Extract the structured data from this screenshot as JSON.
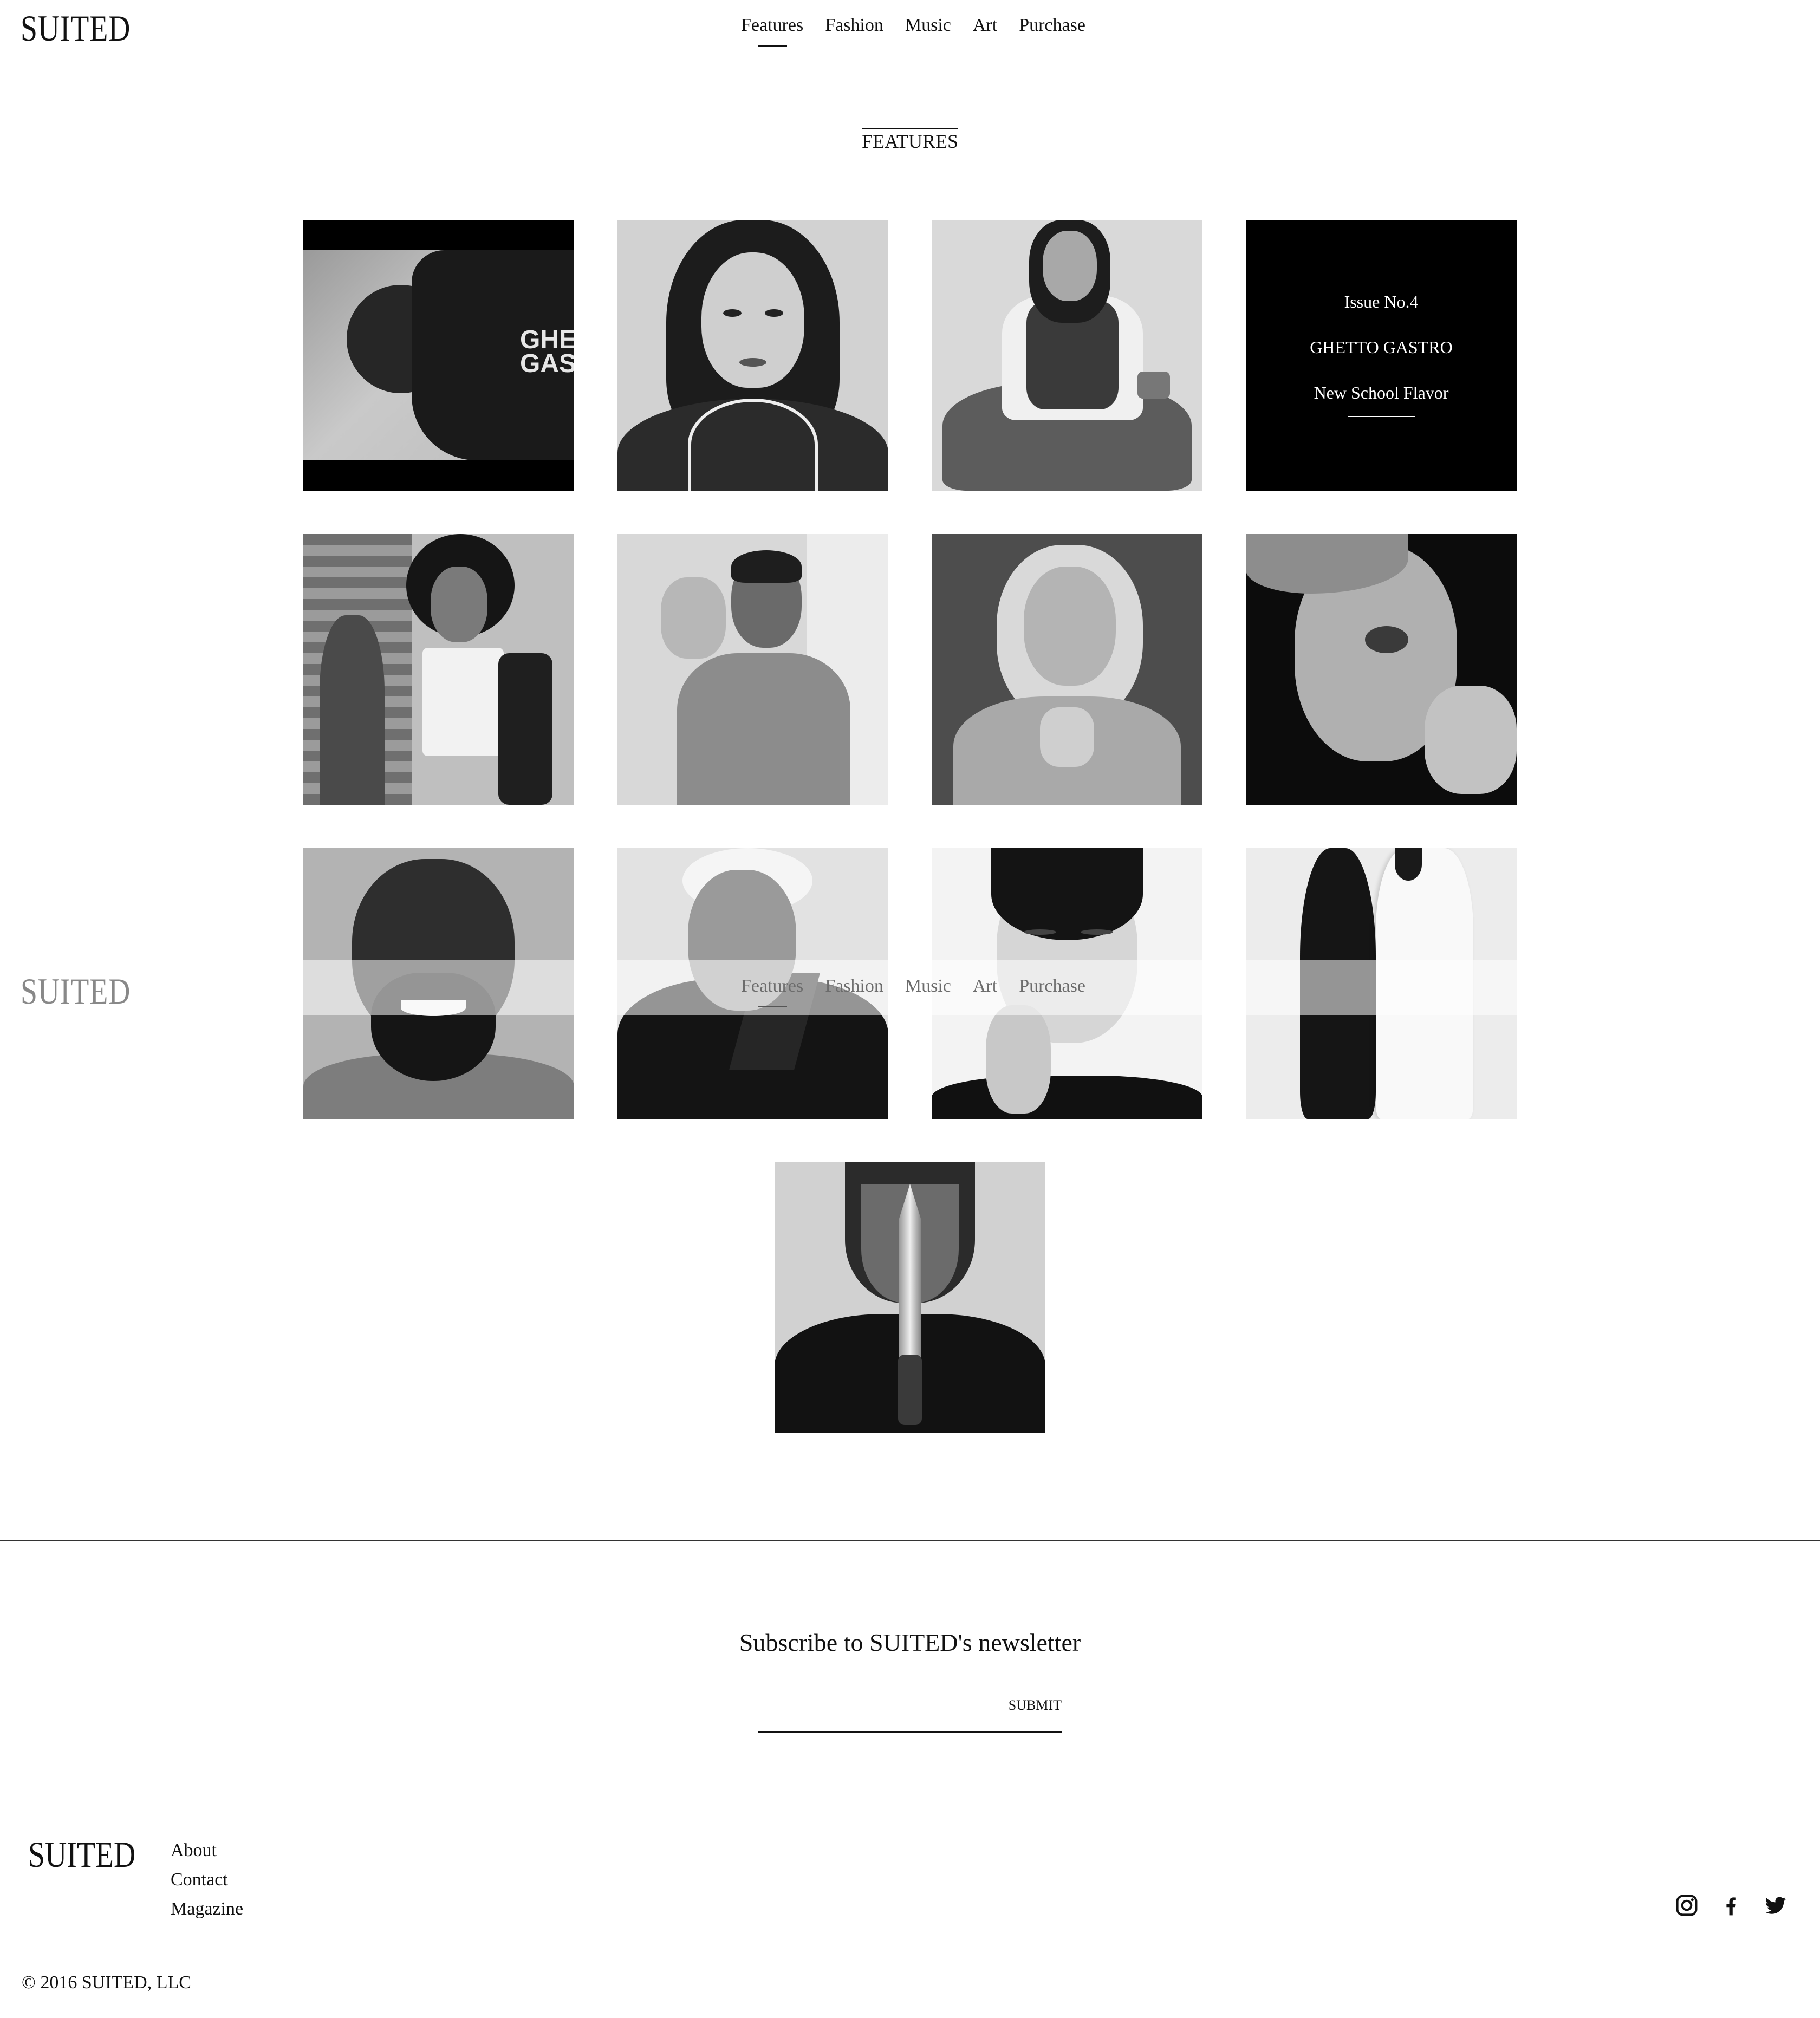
{
  "brand": {
    "logo": "SUITED"
  },
  "nav": {
    "items": [
      {
        "label": "Features",
        "active": true
      },
      {
        "label": "Fashion",
        "active": false
      },
      {
        "label": "Music",
        "active": false
      },
      {
        "label": "Art",
        "active": false
      },
      {
        "label": "Purchase",
        "active": false
      }
    ]
  },
  "section": {
    "title": "FEATURES"
  },
  "tile1": {
    "print_line1": "GHE",
    "print_line2": "GAS"
  },
  "issue_card": {
    "issue": "Issue No.4",
    "title": "GHETTO GASTRO",
    "subtitle": "New School Flavor"
  },
  "newsletter": {
    "title": "Subscribe to SUITED's newsletter",
    "submit_label": "SUBMIT"
  },
  "footer": {
    "logo": "SUITED",
    "links": [
      "About",
      "Contact",
      "Magazine"
    ],
    "social": [
      "instagram-icon",
      "facebook-icon",
      "twitter-icon"
    ],
    "copyright": "© 2016 SUITED, LLC"
  },
  "colors": {
    "text": "#111111",
    "background": "#ffffff",
    "card": "#000000"
  }
}
